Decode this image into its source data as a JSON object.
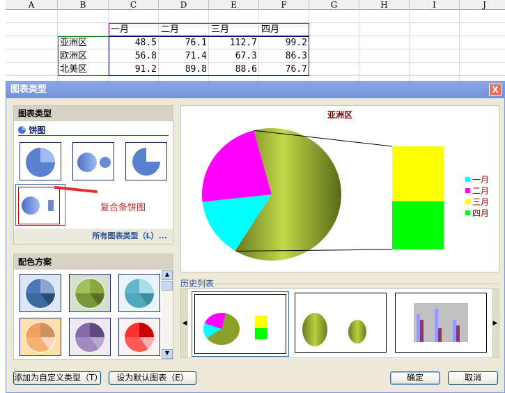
{
  "sheet": {
    "columns": [
      "A",
      "B",
      "C",
      "D",
      "E",
      "F",
      "G",
      "H",
      "I",
      "J"
    ],
    "months": [
      "一月",
      "二月",
      "三月",
      "四月"
    ],
    "rows": [
      {
        "region": "亚洲区",
        "values": [
          "48.5",
          "76.1",
          "112.7",
          "99.2"
        ]
      },
      {
        "region": "欧洲区",
        "values": [
          "56.8",
          "71.4",
          "67.3",
          "86.3"
        ]
      },
      {
        "region": "北美区",
        "values": [
          "91.2",
          "89.8",
          "88.6",
          "76.7"
        ]
      }
    ]
  },
  "dialog": {
    "title": "图表类型",
    "close": "X",
    "chart_type_header": "图表类型",
    "category": "饼图",
    "annotation": "复合条饼图",
    "all_types_link": "所有图表类型（L）...",
    "color_scheme_header": "配色方案",
    "history_label": "历史列表",
    "buttons": {
      "add_custom": "添加为自定义类型（T）",
      "set_default": "设为默认图表（E）",
      "ok": "确定",
      "cancel": "取消"
    }
  },
  "chart_data": {
    "type": "pie",
    "subtype": "bar-of-pie",
    "title": "亚洲区",
    "categories": [
      "一月",
      "二月",
      "三月",
      "四月"
    ],
    "values": [
      48.5,
      76.1,
      112.7,
      99.2
    ],
    "colors": [
      "#00ffff",
      "#ff00ff",
      "#ffff00",
      "#00ff00"
    ],
    "legend": "right"
  }
}
